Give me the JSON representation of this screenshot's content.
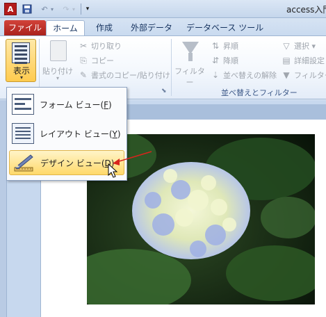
{
  "titlebar": {
    "app_icon_letter": "A",
    "window_title": "access入門",
    "undo_dropdown": "▾",
    "redo_dropdown": "▾",
    "customize_glyph": "▾"
  },
  "tabs": {
    "file": "ファイル",
    "home": "ホーム",
    "create": "作成",
    "external_data": "外部データ",
    "database_tools": "データベース ツール"
  },
  "ribbon": {
    "view_label": "表示",
    "view_caret": "▾",
    "paste_label": "貼り付け",
    "paste_caret": "▾",
    "cut": "切り取り",
    "copy": "コピー",
    "format_painter": "書式のコピー/貼り付け",
    "filter": "フィルター",
    "sort_asc": "昇順",
    "sort_desc": "降順",
    "clear_sort": "並べ替えの解除",
    "selection": "選択 ▾",
    "advanced": "詳細設定",
    "toggle_filter": "フィルターの",
    "sort_filter_group": "並べ替えとフィルター"
  },
  "view_menu": {
    "items": [
      {
        "label": "フォーム ビュー(",
        "key": "F",
        "suffix": ")"
      },
      {
        "label": "レイアウト ビュー(",
        "key": "Y",
        "suffix": ")"
      },
      {
        "label": "デザイン ビュー(",
        "key": "D",
        "suffix": ")"
      }
    ]
  },
  "colors": {
    "file_tab": "#c3312b",
    "highlight": "#ffd96a",
    "arrow": "#d8241c"
  }
}
